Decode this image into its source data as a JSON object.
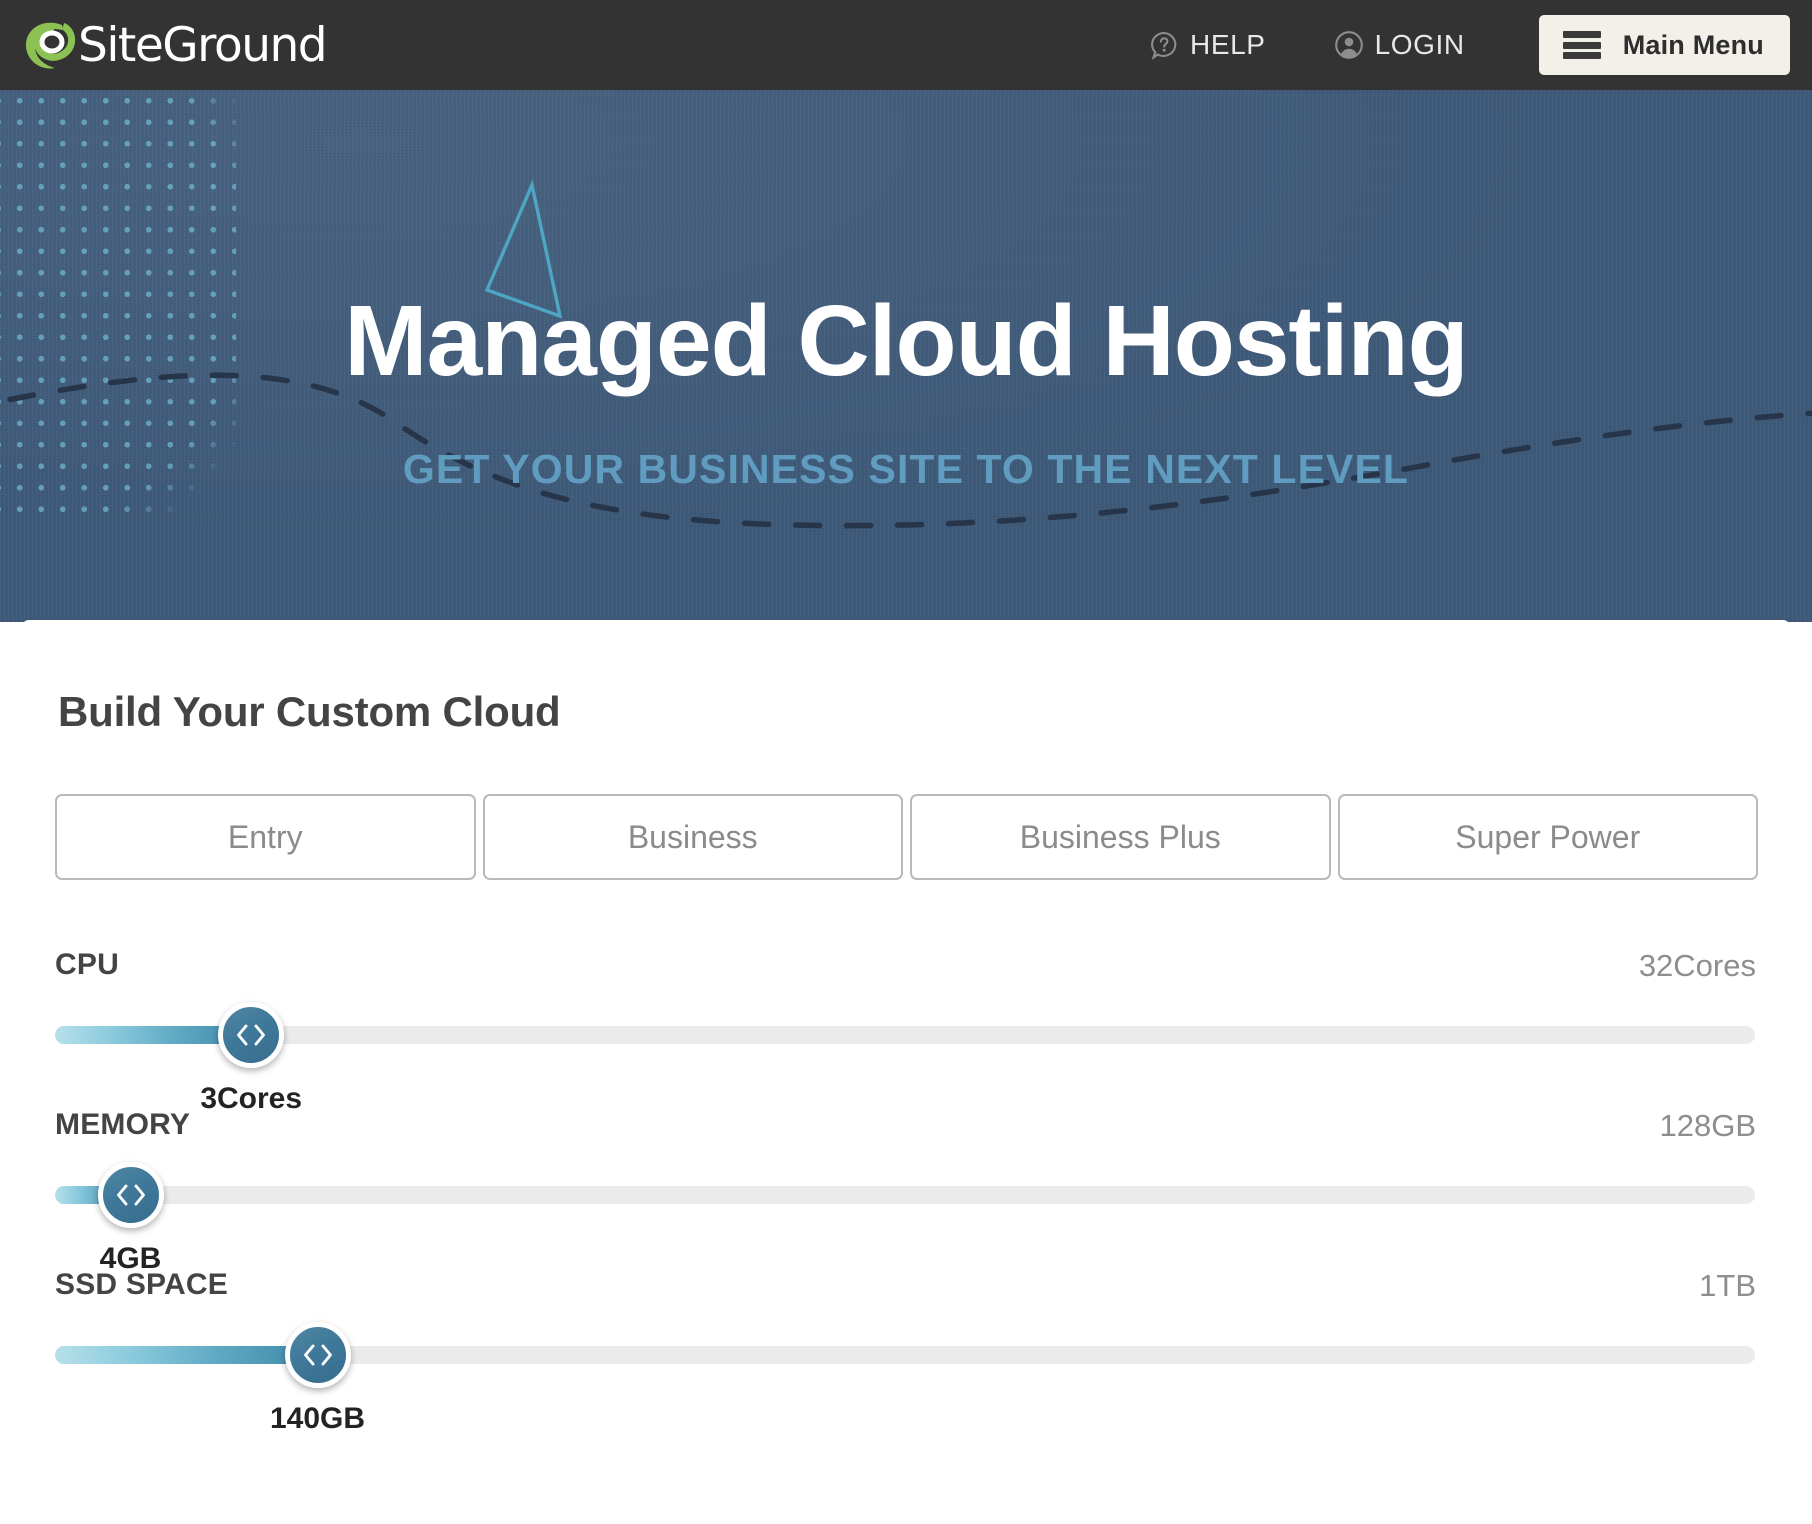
{
  "header": {
    "logo_text": "SiteGround",
    "logo_icon": "siteground-leaf-logo",
    "help_label": "HELP",
    "help_icon": "question-bubble-icon",
    "login_label": "LOGIN",
    "login_icon": "user-avatar-icon",
    "main_menu_label": "Main Menu",
    "main_menu_icon": "hamburger-icon",
    "bar_color": "#333333",
    "menu_button_color": "#f3efe9"
  },
  "hero": {
    "title": "Managed Cloud Hosting",
    "subtitle": "GET YOUR BUSINESS SITE TO THE NEXT LEVEL",
    "background_color": "#3e5a79",
    "subtitle_color": "#5f9cc0",
    "triangle_color": "#4fa5c4",
    "dot_color": "#6fb6cf",
    "dash_color": "#27354a"
  },
  "card": {
    "title": "Build Your Custom Cloud",
    "title_color": "#444444",
    "tabs": [
      {
        "label": "Entry",
        "selected": false
      },
      {
        "label": "Business",
        "selected": false
      },
      {
        "label": "Business Plus",
        "selected": false
      },
      {
        "label": "Super Power",
        "selected": false
      }
    ],
    "sliders": [
      {
        "label": "CPU",
        "value": "3Cores",
        "max": "32Cores",
        "percent": 9.6
      },
      {
        "label": "MEMORY",
        "value": "4GB",
        "max": "128GB",
        "percent": 2.5
      },
      {
        "label": "SSD SPACE",
        "value": "140GB",
        "max": "1TB",
        "percent": 13.5
      }
    ],
    "handle_icon": "chevron-left-right-icon",
    "track_color": "#ebebeb",
    "fill_color": "#3d87a8"
  }
}
